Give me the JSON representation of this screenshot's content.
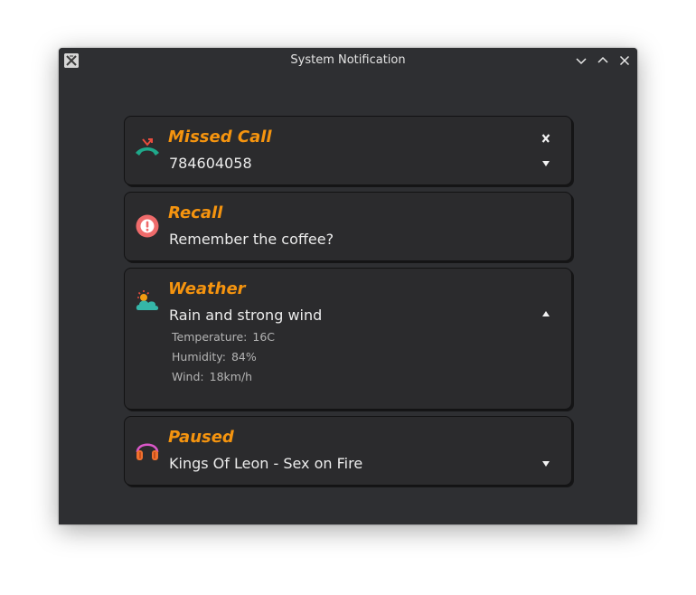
{
  "window": {
    "title": "System Notification"
  },
  "colors": {
    "window_bg": "#2e2f32",
    "card_bg": "#2b2b2d",
    "title_accent": "#f5940f",
    "body_text": "#ececec",
    "detail_text": "#b4b4b4"
  },
  "notifications": [
    {
      "title": "Missed Call",
      "body": "784604058",
      "icon": "missed-call-icon",
      "actions": [
        "close-icon",
        "chevron-down-icon"
      ]
    },
    {
      "title": "Recall",
      "body": "Remember the coffee?",
      "icon": "alert-icon"
    },
    {
      "title": "Weather",
      "body": "Rain and strong wind",
      "icon": "weather-cloud-sun-icon",
      "actions": [
        "chevron-up-icon"
      ],
      "details": [
        {
          "label": "Temperature:",
          "value": "16C"
        },
        {
          "label": "Humidity:",
          "value": "84%"
        },
        {
          "label": "Wind:",
          "value": "18km/h"
        }
      ]
    },
    {
      "title": "Paused",
      "body": "Kings Of Leon - Sex on Fire",
      "icon": "headphones-icon",
      "actions": [
        "chevron-down-icon"
      ]
    }
  ]
}
